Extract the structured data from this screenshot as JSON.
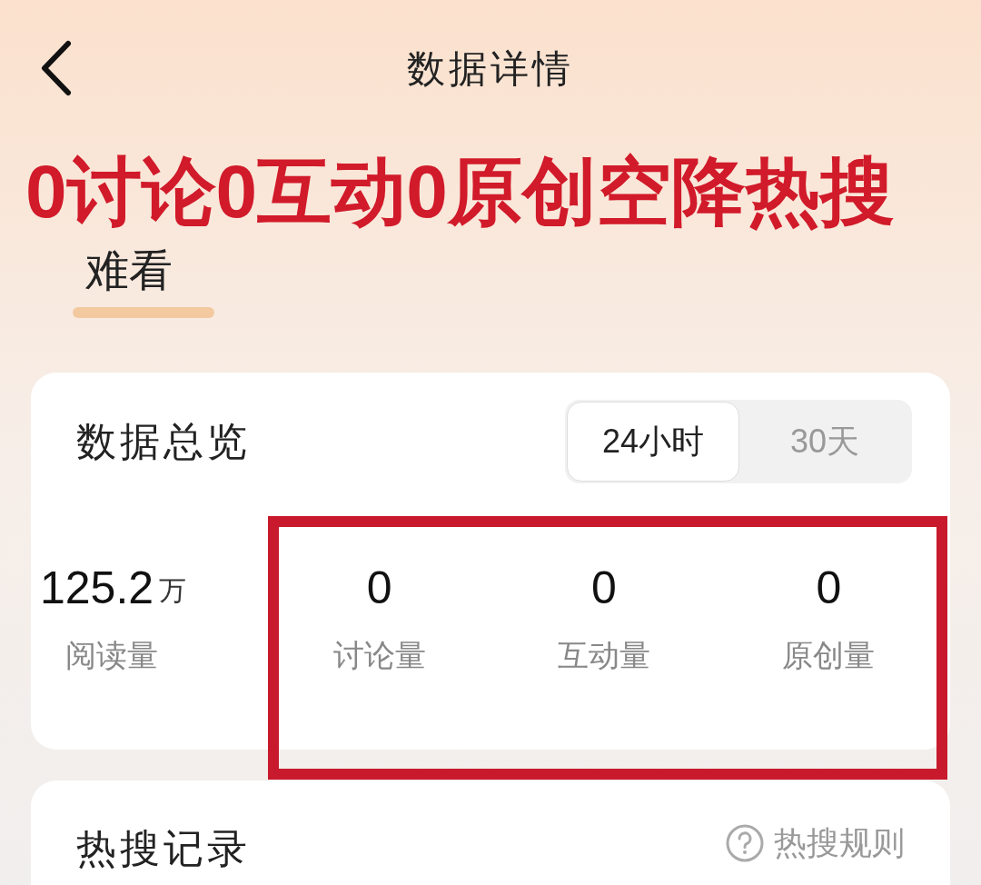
{
  "header": {
    "title": "数据详情"
  },
  "annotation": {
    "headline": "0讨论0互动0原创空降热搜",
    "note": "难看",
    "highlight_box": true
  },
  "overview": {
    "title": "数据总览",
    "tabs": [
      {
        "label": "24小时",
        "selected": true
      },
      {
        "label": "30天",
        "selected": false
      }
    ],
    "main_stat": {
      "value": "125.2",
      "unit": "万",
      "label": "阅读量"
    },
    "stats": [
      {
        "value": "0",
        "label": "讨论量"
      },
      {
        "value": "0",
        "label": "互动量"
      },
      {
        "value": "0",
        "label": "原创量"
      }
    ]
  },
  "hot_search": {
    "title": "热搜记录",
    "rules_link": "热搜规则"
  }
}
